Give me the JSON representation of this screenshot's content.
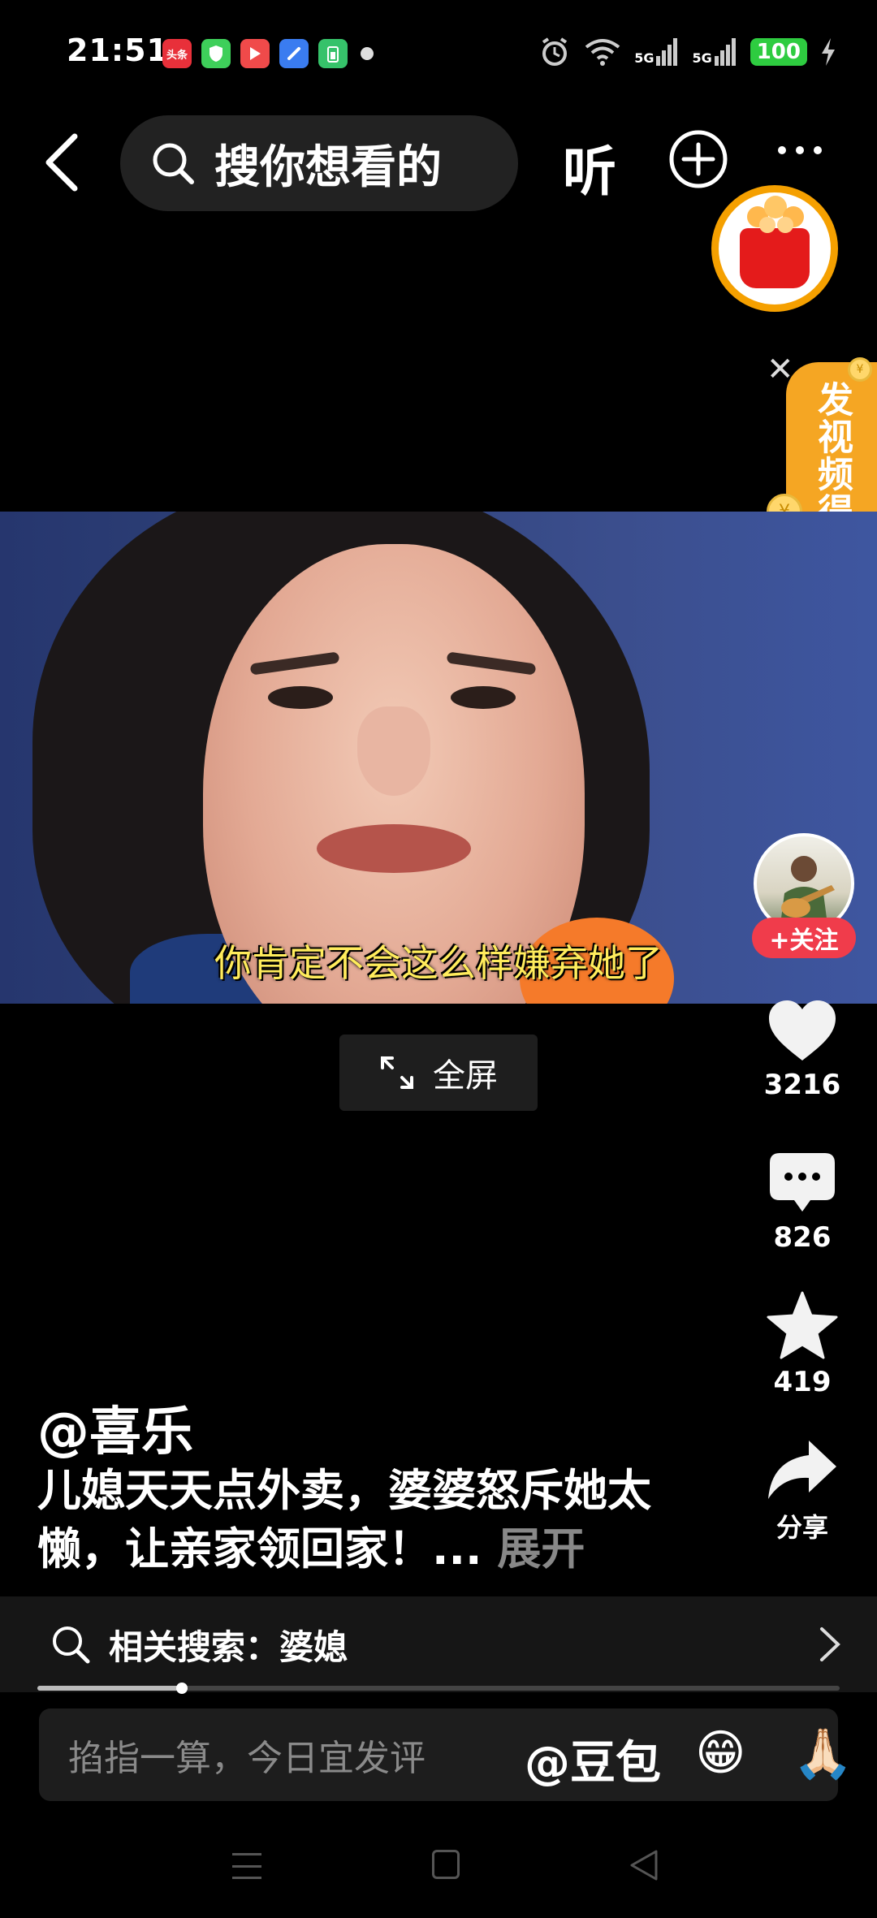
{
  "status_bar": {
    "time": "21:51",
    "apps": [
      {
        "name": "toutiao-app-icon",
        "label": "头条",
        "color": "#e8303a"
      },
      {
        "name": "security-app-icon",
        "label": "",
        "color": "#3ecf5a"
      },
      {
        "name": "video-app-icon",
        "label": "",
        "color": "#f04a4a"
      },
      {
        "name": "browser-app-icon",
        "label": "",
        "color": "#3a7cf0"
      },
      {
        "name": "battery-app-icon",
        "label": "",
        "color": "#36c26a"
      }
    ],
    "network_1": "5G",
    "network_2": "5G",
    "battery": "100"
  },
  "top_nav": {
    "search_placeholder": "搜你想看的",
    "listen_label": "听"
  },
  "reward": {
    "label": "发视频得奖",
    "coin_symbol": "¥"
  },
  "video": {
    "subtitle": "你肯定不会这么样嫌弃她了",
    "fullscreen_label": "全屏"
  },
  "actions": {
    "follow_label": "+关注",
    "likes": "3216",
    "comments": "826",
    "favorites": "419",
    "share_label": "分享"
  },
  "caption": {
    "author": "@喜乐",
    "description": "儿媳天天点外卖，婆婆怒斥她太懒，让亲家领回家！...",
    "expand_label": "展开"
  },
  "related_search": {
    "label": "相关搜索：婆媳"
  },
  "playback": {
    "progress_fraction": 0.18
  },
  "comment_bar": {
    "placeholder": "掐指一算，今日宜发评",
    "mention": "@豆包",
    "emoji_1": "😁",
    "emoji_2": "🙏🏻"
  }
}
